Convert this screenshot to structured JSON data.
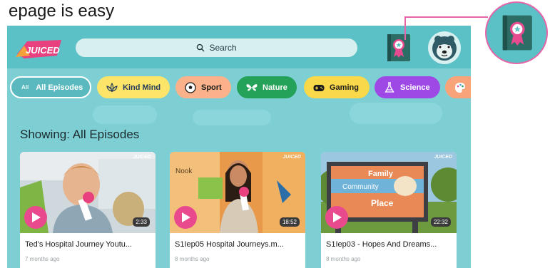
{
  "tagline": "epage is easy",
  "app": {
    "logo_text": "JUICED",
    "search": {
      "label": "Search"
    },
    "chips": [
      {
        "tag": "All",
        "label": "All Episodes",
        "icon": "all-icon"
      },
      {
        "label": "Kind Mind",
        "icon": "lotus-icon"
      },
      {
        "label": "Sport",
        "icon": "soccer-ball-icon"
      },
      {
        "label": "Nature",
        "icon": "butterfly-icon"
      },
      {
        "label": "Gaming",
        "icon": "gamepad-icon"
      },
      {
        "label": "Science",
        "icon": "flask-icon"
      },
      {
        "label": "",
        "icon": "palette-icon"
      }
    ],
    "showing": "Showing: All Episodes",
    "cards": [
      {
        "title": "Ted's Hospital Journey Youtu...",
        "age": "7 months ago",
        "duration": "2:33",
        "watermark": "JUICED"
      },
      {
        "title": "S1Iep05 Hospital Journeys.m...",
        "age": "8 months ago",
        "duration": "18:52",
        "watermark": "JUICED"
      },
      {
        "title": "S1Iep03 - Hopes And Dreams...",
        "age": "8 months ago",
        "duration": "22:32",
        "watermark": "JUICED"
      }
    ],
    "sign": {
      "line1": "Family",
      "line2": "Community",
      "line3": "Place"
    },
    "mural_text": "Nook"
  },
  "colors": {
    "accent_teal": "#5bc1c6",
    "background": "#7dcfd3",
    "play_pink": "#e94a8d",
    "callout_border": "#e664a8"
  }
}
